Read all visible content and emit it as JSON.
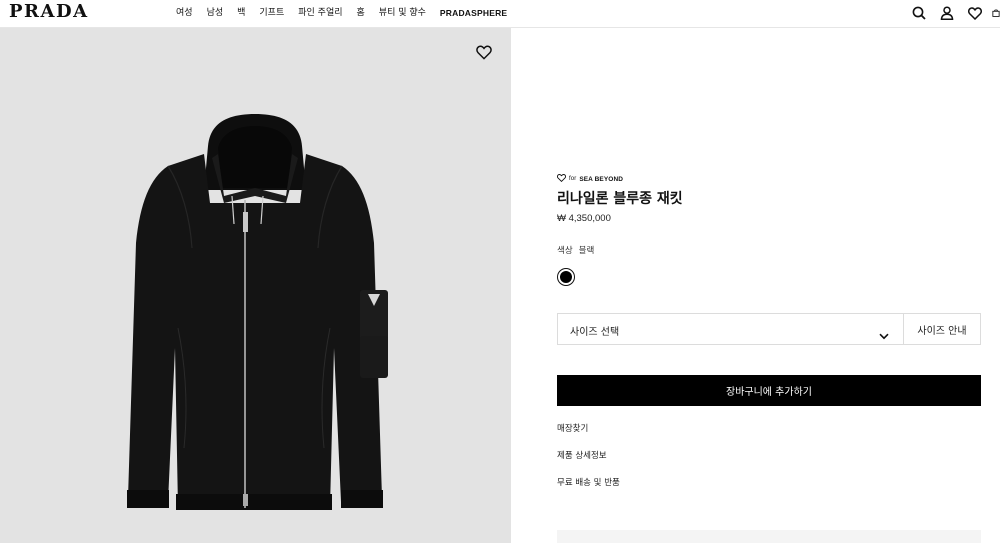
{
  "header": {
    "logo": "PRADA",
    "nav": [
      "여성",
      "남성",
      "백",
      "기프트",
      "파인 주얼리",
      "홈",
      "뷰티 및 향수",
      "PRADASPHERE"
    ],
    "icons": [
      "search-icon",
      "account-icon",
      "wishlist-icon",
      "bag-icon"
    ]
  },
  "product": {
    "brand_prefix": "for",
    "brand": "SEA BEYOND",
    "title": "리나일론 블루종 재킷",
    "price": "₩ 4,350,000",
    "color_label": "색상",
    "color_value": "블랙",
    "swatch_color": "#000000",
    "size_placeholder": "사이즈 선택",
    "size_guide": "사이즈 안내",
    "add_to_cart": "장바구니에 추가하기",
    "links": [
      "매장찾기",
      "제품 상세정보",
      "무료 배송 및 반품"
    ]
  },
  "colors": {
    "image_bg": "#e3e3e3",
    "button_bg": "#000000",
    "jacket": "#121212"
  }
}
